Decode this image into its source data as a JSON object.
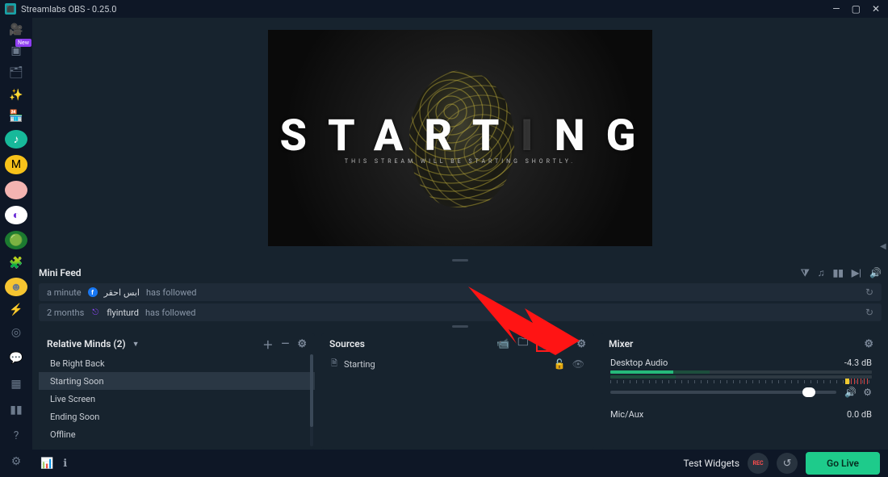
{
  "titlebar": {
    "app": "Streamlabs OBS - 0.25.0"
  },
  "preview": {
    "title_left": "START",
    "title_cut": "I",
    "title_right": "NG",
    "sub": "THIS STREAM WILL BE STARTING SHORTLY."
  },
  "minifeed": {
    "title": "Mini Feed",
    "items": [
      {
        "age": "a minute",
        "platform": "fb",
        "name": "ابس احقر",
        "action": "has followed"
      },
      {
        "age": "2 months",
        "platform": "twitch",
        "name": "flyinturd",
        "action": "has followed"
      }
    ]
  },
  "scenes": {
    "title": "Relative Minds (2)",
    "items": [
      "Be Right Back",
      "Starting Soon",
      "Live Screen",
      "Ending Soon",
      "Offline"
    ],
    "selected": 1
  },
  "sources": {
    "title": "Sources",
    "items": [
      {
        "name": "Starting"
      }
    ]
  },
  "mixer": {
    "title": "Mixer",
    "channels": [
      {
        "name": "Desktop Audio",
        "db": "-4.3 dB"
      },
      {
        "name": "Mic/Aux",
        "db": "0.0 dB"
      }
    ]
  },
  "footer": {
    "test_widgets": "Test Widgets",
    "rec": "REC",
    "go_live": "Go Live"
  }
}
